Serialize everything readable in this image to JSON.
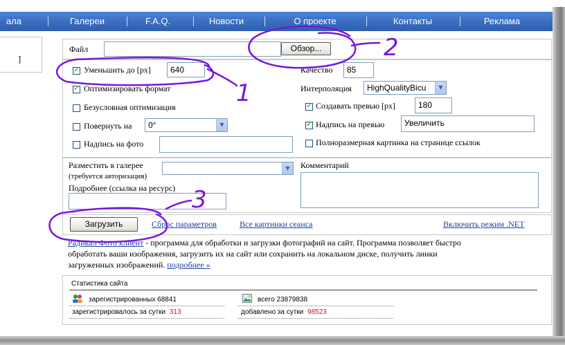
{
  "nav": {
    "items": [
      "ала",
      "Галереи",
      "F.A.Q.",
      "Новости",
      "О проекте",
      "Контакты",
      "Реклама"
    ]
  },
  "left": {
    "fragment": "]"
  },
  "file": {
    "label": "Файл",
    "value": "",
    "browse_label": "Обзор..."
  },
  "options": {
    "resize": {
      "label": "Уменьшить до [px]",
      "checked": true,
      "value": "640"
    },
    "optimize": {
      "label": "Оптимизировать формат",
      "checked": true
    },
    "force_opt": {
      "label": "Безусловная оптимизация",
      "checked": false
    },
    "rotate": {
      "label": "Повернуть на",
      "checked": false,
      "value": "0°"
    },
    "photo_caption": {
      "label": "Надпись на фото",
      "checked": false,
      "value": ""
    }
  },
  "quality": {
    "label": "Качество",
    "value": "85"
  },
  "interpolation": {
    "label": "Интерполяция",
    "value": "HighQualityBicu"
  },
  "preview": {
    "label": "Создавать превью [px]",
    "checked": true,
    "value": "180"
  },
  "preview_caption": {
    "label": "Надпись на превью",
    "checked": true,
    "value": "Увеличить"
  },
  "fullsize": {
    "label": "Полноразмерная картинка на странице ссылок",
    "checked": false
  },
  "gallery": {
    "label": "Разместить в галерее",
    "note": "(требуется авторизация)",
    "value": "",
    "more_label": "Подробнее (ссылка на ресурс)",
    "more_value": ""
  },
  "comment": {
    "label": "Комментарий",
    "value": ""
  },
  "actions": {
    "upload": "Загрузить",
    "reset": "Сброс параметров",
    "session": "Все картинки сеанса",
    "net_mode": "Включить режим .NET"
  },
  "promo": {
    "link": "Радикал Фото клиент",
    "text1": " - программа для обработки и загрузки фотографий на сайт. Программа позволяет быстро",
    "text2": "обработать ваши изображения, загрузить их на сайт или сохранить на локальном диске, получить линки",
    "text3": "загруженных изображений. ",
    "more": "подробнее »"
  },
  "stats": {
    "title": "Статистика сайта",
    "registered_label": "зарегистрированных",
    "registered": "68841",
    "total_label": "всего",
    "total": "23879838",
    "day_reg_label": "зарегистрировалось за сутки",
    "day_reg": "313",
    "day_add_label": "добавлено за сутки",
    "day_add": "98523"
  },
  "annotations": {
    "n1": "1",
    "n2": "2",
    "n3": "3"
  },
  "colors": {
    "nav": "#3a6cbf",
    "annotation": "#7a16d8",
    "check": "#24a01d",
    "link": "#1a3f9c",
    "stat_red": "#c8141c"
  }
}
